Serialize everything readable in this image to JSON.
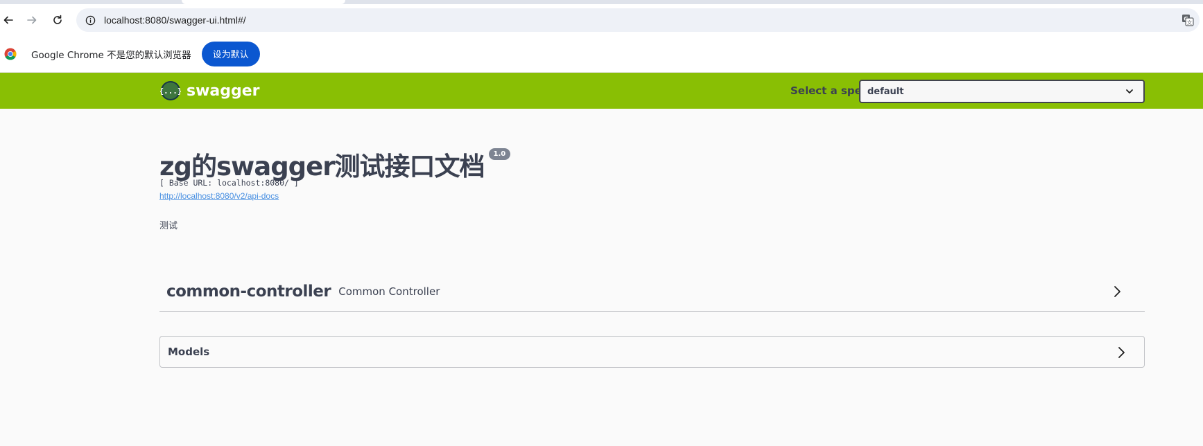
{
  "browser": {
    "url": "localhost:8080/swagger-ui.html#/",
    "infobar": {
      "message": "Google Chrome 不是您的默认浏览器",
      "button_label": "设为默认"
    }
  },
  "topbar": {
    "logo_text": "swagger",
    "logo_glyph": "{...}",
    "spec_label": "Select a spec",
    "spec_value": "default",
    "color": "#89bf04"
  },
  "info": {
    "title": "zg的swagger测试接口文档",
    "version": "1.0",
    "base_url": "[ Base URL: localhost:8080/ ]",
    "api_docs_link": "http://localhost:8080/v2/api-docs",
    "description": "测试"
  },
  "tags": [
    {
      "name": "common-controller",
      "description": "Common Controller"
    }
  ],
  "models": {
    "title": "Models"
  }
}
